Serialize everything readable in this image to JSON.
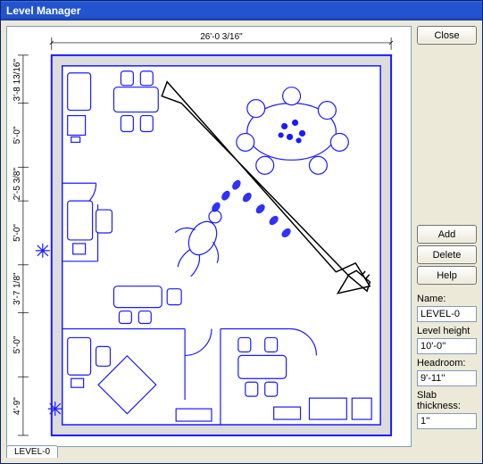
{
  "window": {
    "title": "Level Manager"
  },
  "buttons": {
    "close": "Close",
    "add": "Add",
    "delete": "Delete",
    "help": "Help"
  },
  "fields": {
    "name_label": "Name:",
    "name_value": "LEVEL-0",
    "level_height_label": "Level height",
    "level_height_value": "10'-0''",
    "headroom_label": "Headroom:",
    "headroom_value": "9'-11''",
    "slab_label": "Slab thickness:",
    "slab_value": "1''"
  },
  "tab": {
    "label": "LEVEL-0"
  },
  "dimensions": {
    "top": "26'-0 3/16\"",
    "left_seg1": "3'-8 13/16\"",
    "left_seg2": "5'-0\"",
    "left_seg3": "2'-5 3/8\"",
    "left_seg4": "5'-0\"",
    "left_seg5": "3'-7 1/8\"",
    "left_seg6": "5'-0\"",
    "left_seg7": "4'-9\""
  }
}
